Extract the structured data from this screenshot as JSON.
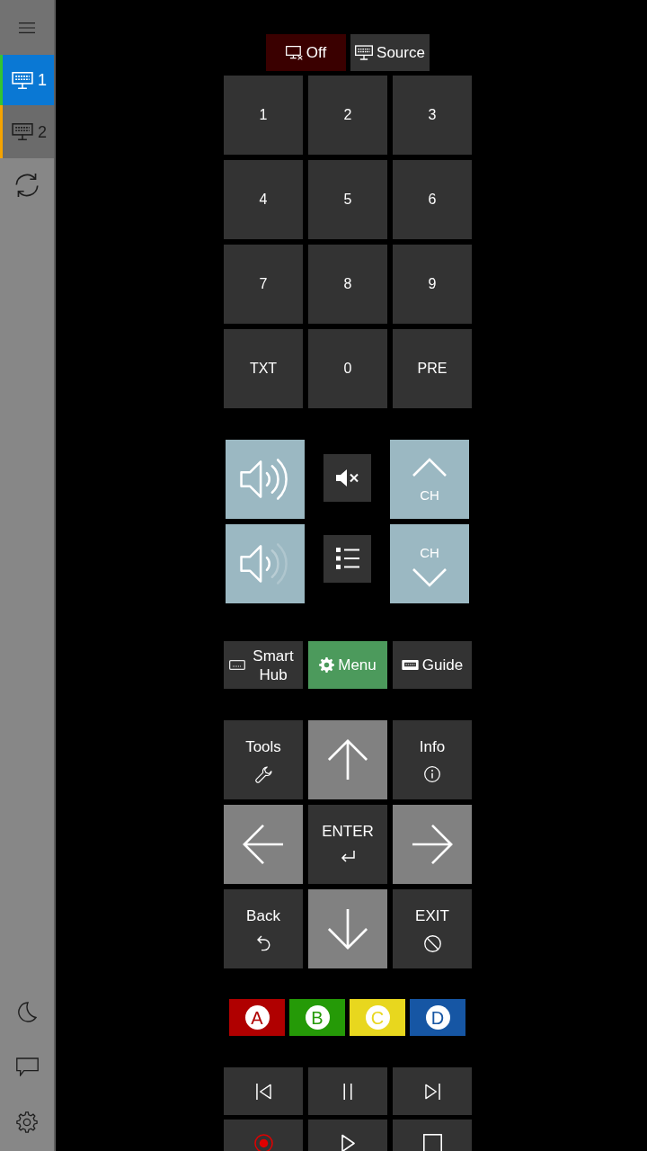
{
  "sidebar": {
    "devices": [
      {
        "label": "1",
        "selected": true,
        "color": "#33c433"
      },
      {
        "label": "2",
        "selected": false,
        "color": "#f5a300"
      }
    ]
  },
  "power_row": [
    {
      "kind": "off",
      "label": "Off"
    },
    {
      "kind": "source",
      "label": "Source"
    }
  ],
  "keypad": [
    "1",
    "2",
    "3",
    "4",
    "5",
    "6",
    "7",
    "8",
    "9",
    "TXT",
    "0",
    "PRE"
  ],
  "volume_channel": {
    "channel_up": {
      "label": "CH"
    },
    "channel_down": {
      "label": "CH"
    }
  },
  "menu_row": [
    {
      "kind": "smart_hub",
      "label": "Smart Hub"
    },
    {
      "kind": "menu",
      "label": "Menu"
    },
    {
      "kind": "guide",
      "label": "Guide"
    }
  ],
  "navigation": [
    {
      "kind": "tools",
      "label": "Tools"
    },
    {
      "kind": "up"
    },
    {
      "kind": "info",
      "label": "Info"
    },
    {
      "kind": "left"
    },
    {
      "kind": "enter",
      "label": "ENTER"
    },
    {
      "kind": "right"
    },
    {
      "kind": "back",
      "label": "Back"
    },
    {
      "kind": "down"
    },
    {
      "kind": "exit",
      "label": "EXIT"
    }
  ],
  "color_buttons": [
    {
      "label": "A",
      "color": "#b00000"
    },
    {
      "label": "B",
      "color": "#259a07"
    },
    {
      "label": "C",
      "color": "#e8d71e"
    },
    {
      "label": "D",
      "color": "#1656a4"
    }
  ],
  "media": [
    {
      "kind": "previous"
    },
    {
      "kind": "pause"
    },
    {
      "kind": "next"
    },
    {
      "kind": "record"
    },
    {
      "kind": "play"
    },
    {
      "kind": "stop"
    }
  ]
}
